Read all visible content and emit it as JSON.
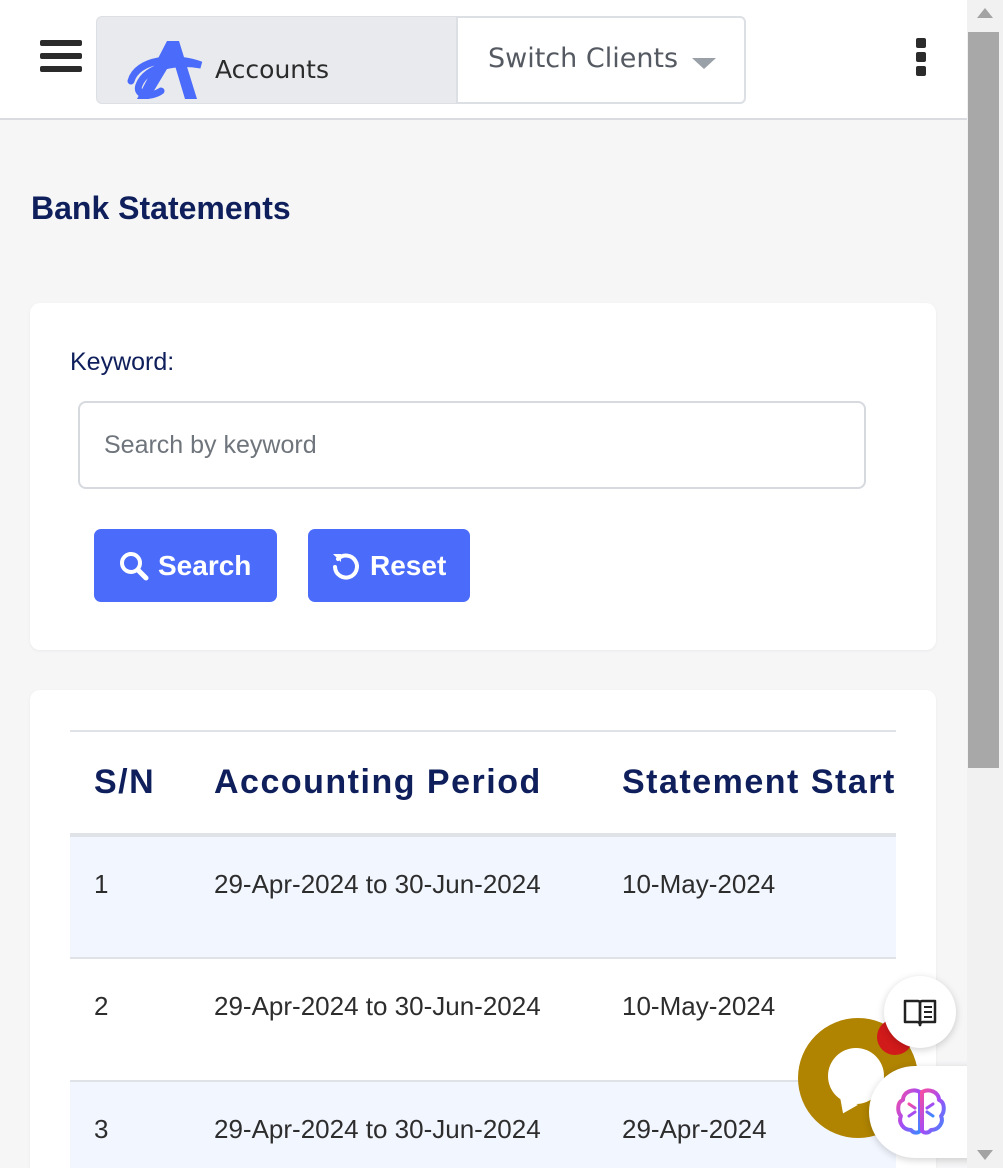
{
  "header": {
    "app_name": "Accounts",
    "switch_clients_label": "Switch Clients"
  },
  "page": {
    "title": "Bank Statements"
  },
  "search": {
    "keyword_label": "Keyword:",
    "keyword_value": "",
    "keyword_placeholder": "Search by keyword",
    "search_button": "Search",
    "reset_button": "Reset"
  },
  "table": {
    "columns": [
      "S/N",
      "Accounting Period",
      "Statement Start"
    ],
    "rows": [
      {
        "sn": "1",
        "period": "29-Apr-2024 to 30-Jun-2024",
        "start": "10-May-2024"
      },
      {
        "sn": "2",
        "period": "29-Apr-2024 to 30-Jun-2024",
        "start": "10-May-2024"
      },
      {
        "sn": "3",
        "period": "29-Apr-2024 to 30-Jun-2024",
        "start": "29-Apr-2024"
      }
    ]
  },
  "icons": {
    "menu": "hamburger-icon",
    "logo": "accounts-logo",
    "dropdown": "chevron-down-icon",
    "more": "kebab-icon",
    "search": "search-icon",
    "reset": "reset-icon",
    "book": "book-icon",
    "chat": "chat-icon",
    "brain": "brain-icon"
  },
  "colors": {
    "primary": "#4b6bfb",
    "title": "#0f1f5c",
    "chat_fab": "#b08400",
    "badge": "#d11a1a",
    "row_highlight": "#f2f6fe"
  }
}
